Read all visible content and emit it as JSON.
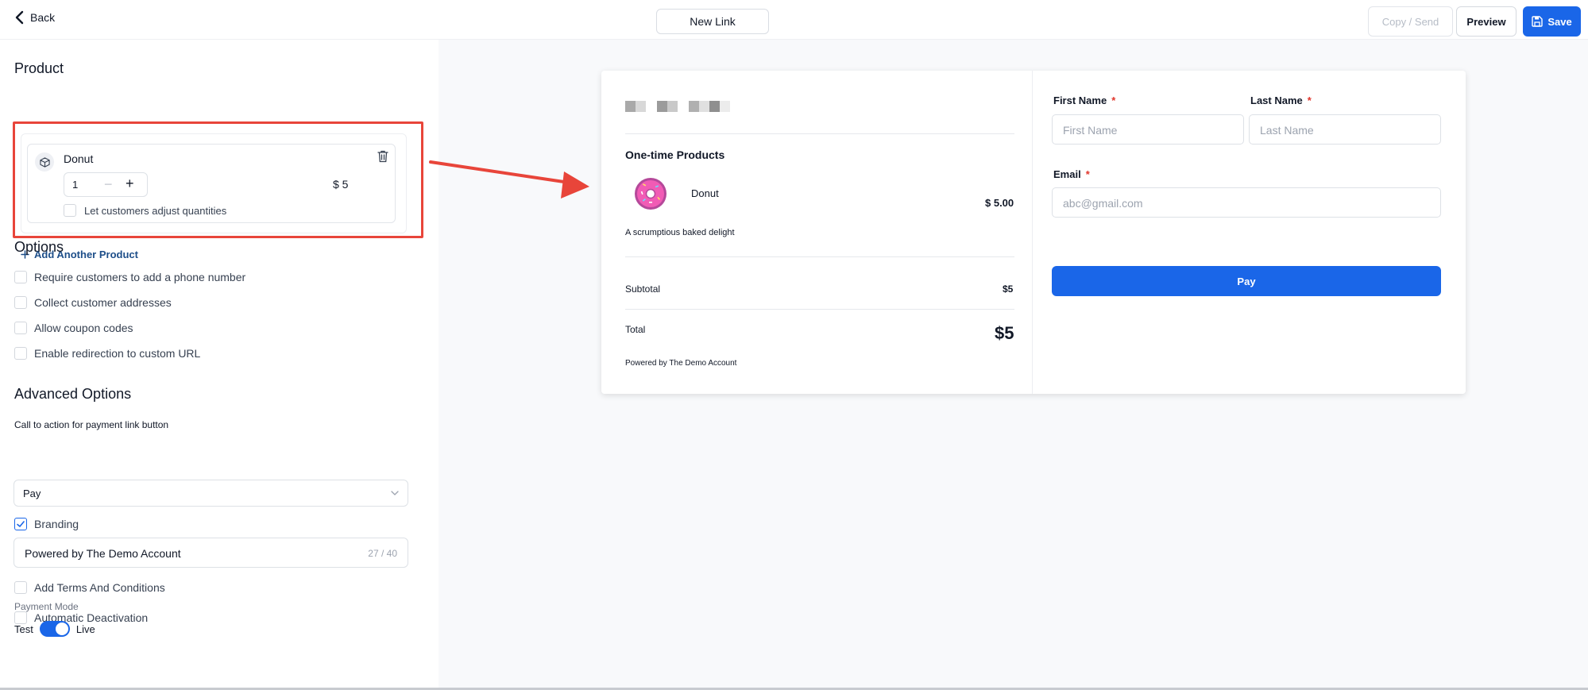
{
  "topbar": {
    "back_label": "Back",
    "link_title": "New Link",
    "copy_send_label": "Copy / Send",
    "preview_label": "Preview",
    "save_label": "Save"
  },
  "product_section": {
    "title": "Product",
    "product": {
      "name": "Donut",
      "quantity": "1",
      "minus": "−",
      "plus": "+",
      "price": "$ 5",
      "adjust_label": "Let customers adjust quantities"
    },
    "add_another_label": "Add Another Product"
  },
  "options": {
    "title": "Options",
    "items": [
      {
        "label": "Require customers to add a phone number",
        "checked": false
      },
      {
        "label": "Collect customer addresses",
        "checked": false
      },
      {
        "label": "Allow coupon codes",
        "checked": false
      },
      {
        "label": "Enable redirection to custom URL",
        "checked": false
      }
    ]
  },
  "advanced": {
    "title": "Advanced Options",
    "cta_label": "Call to action for payment link button",
    "cta_value": "Pay",
    "branding_label": "Branding",
    "branding_checked": true,
    "branding_value": "Powered by The Demo Account",
    "branding_count": "27 / 40",
    "terms_label": "Add Terms And Conditions",
    "deactivation_label": "Automatic Deactivation",
    "payment_mode_label": "Payment Mode",
    "mode_test": "Test",
    "mode_live": "Live",
    "mode_is_live": true
  },
  "preview": {
    "section_heading": "One-time Products",
    "product_name": "Donut",
    "product_price": "$ 5.00",
    "product_description": "A scrumptious baked delight",
    "subtotal_label": "Subtotal",
    "subtotal_value": "$5",
    "total_label": "Total",
    "total_value": "$5",
    "powered_by": "Powered by The Demo Account",
    "first_name_label": "First Name",
    "first_name_placeholder": "First Name",
    "last_name_label": "Last Name",
    "last_name_placeholder": "Last Name",
    "email_label": "Email",
    "email_placeholder": "abc@gmail.com",
    "required_mark": "*",
    "pay_label": "Pay"
  },
  "colors": {
    "accent": "#1a66e8",
    "highlight": "#e8453a",
    "required": "#e0352b"
  },
  "icons": [
    "chevron-left-icon",
    "save-icon",
    "cube-icon",
    "trash-icon",
    "plus-icon",
    "chevron-down-icon",
    "check-icon",
    "donut-icon",
    "arrow-annotation"
  ]
}
